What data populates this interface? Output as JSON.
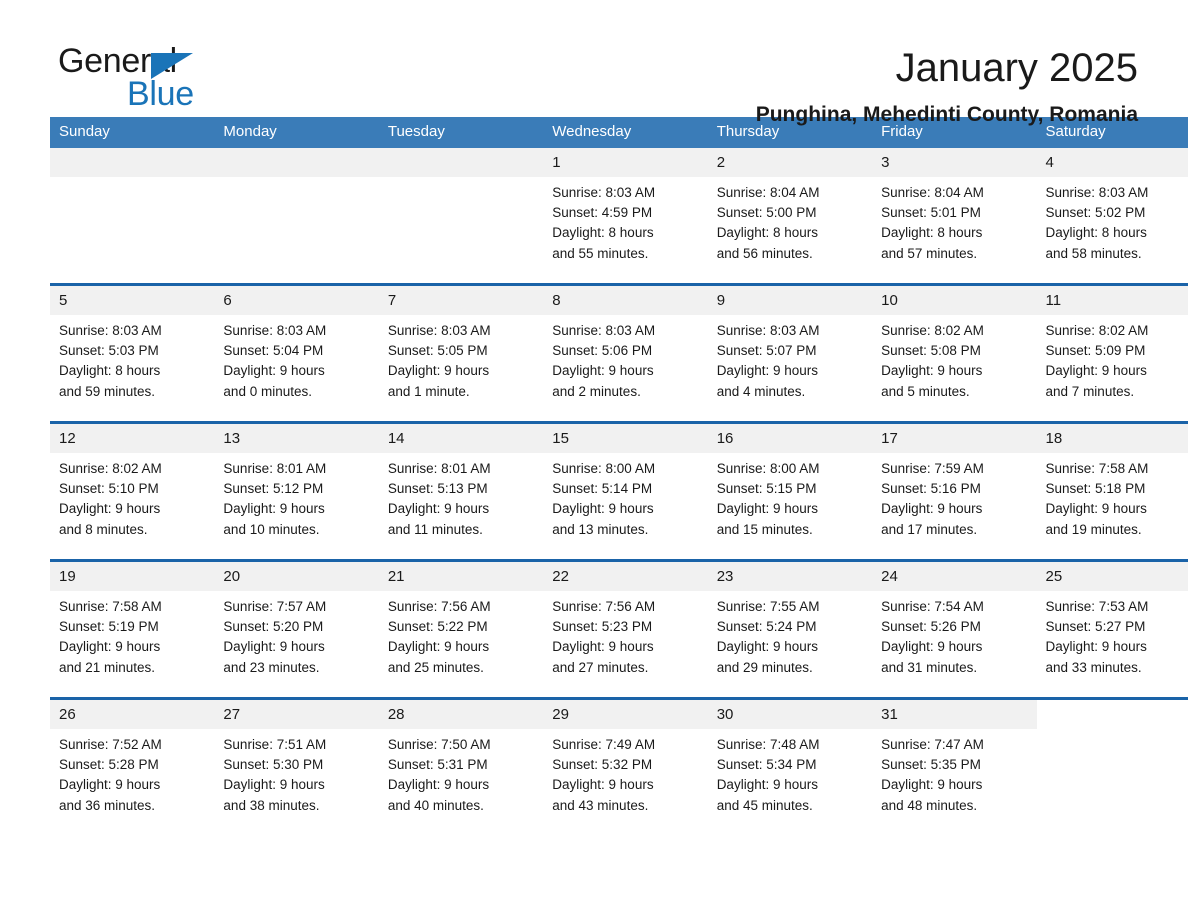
{
  "brand": {
    "name_part1": "General",
    "name_part2": "Blue",
    "triangle_color": "#1a74b8"
  },
  "header": {
    "title": "January 2025",
    "location": "Punghina, Mehedinti County, Romania"
  },
  "calendar": {
    "accent_color": "#3a7cb8",
    "rule_color": "#1a63a8",
    "daynum_bg": "#f1f1f1",
    "weekday_headers": [
      "Sunday",
      "Monday",
      "Tuesday",
      "Wednesday",
      "Thursday",
      "Friday",
      "Saturday"
    ],
    "weeks": [
      [
        {
          "day": "",
          "sunrise": "",
          "sunset": "",
          "daylight1": "",
          "daylight2": "",
          "blank": true
        },
        {
          "day": "",
          "sunrise": "",
          "sunset": "",
          "daylight1": "",
          "daylight2": "",
          "blank": true
        },
        {
          "day": "",
          "sunrise": "",
          "sunset": "",
          "daylight1": "",
          "daylight2": "",
          "blank": true
        },
        {
          "day": "1",
          "sunrise": "Sunrise: 8:03 AM",
          "sunset": "Sunset: 4:59 PM",
          "daylight1": "Daylight: 8 hours",
          "daylight2": "and 55 minutes."
        },
        {
          "day": "2",
          "sunrise": "Sunrise: 8:04 AM",
          "sunset": "Sunset: 5:00 PM",
          "daylight1": "Daylight: 8 hours",
          "daylight2": "and 56 minutes."
        },
        {
          "day": "3",
          "sunrise": "Sunrise: 8:04 AM",
          "sunset": "Sunset: 5:01 PM",
          "daylight1": "Daylight: 8 hours",
          "daylight2": "and 57 minutes."
        },
        {
          "day": "4",
          "sunrise": "Sunrise: 8:03 AM",
          "sunset": "Sunset: 5:02 PM",
          "daylight1": "Daylight: 8 hours",
          "daylight2": "and 58 minutes."
        }
      ],
      [
        {
          "day": "5",
          "sunrise": "Sunrise: 8:03 AM",
          "sunset": "Sunset: 5:03 PM",
          "daylight1": "Daylight: 8 hours",
          "daylight2": "and 59 minutes."
        },
        {
          "day": "6",
          "sunrise": "Sunrise: 8:03 AM",
          "sunset": "Sunset: 5:04 PM",
          "daylight1": "Daylight: 9 hours",
          "daylight2": "and 0 minutes."
        },
        {
          "day": "7",
          "sunrise": "Sunrise: 8:03 AM",
          "sunset": "Sunset: 5:05 PM",
          "daylight1": "Daylight: 9 hours",
          "daylight2": "and 1 minute."
        },
        {
          "day": "8",
          "sunrise": "Sunrise: 8:03 AM",
          "sunset": "Sunset: 5:06 PM",
          "daylight1": "Daylight: 9 hours",
          "daylight2": "and 2 minutes."
        },
        {
          "day": "9",
          "sunrise": "Sunrise: 8:03 AM",
          "sunset": "Sunset: 5:07 PM",
          "daylight1": "Daylight: 9 hours",
          "daylight2": "and 4 minutes."
        },
        {
          "day": "10",
          "sunrise": "Sunrise: 8:02 AM",
          "sunset": "Sunset: 5:08 PM",
          "daylight1": "Daylight: 9 hours",
          "daylight2": "and 5 minutes."
        },
        {
          "day": "11",
          "sunrise": "Sunrise: 8:02 AM",
          "sunset": "Sunset: 5:09 PM",
          "daylight1": "Daylight: 9 hours",
          "daylight2": "and 7 minutes."
        }
      ],
      [
        {
          "day": "12",
          "sunrise": "Sunrise: 8:02 AM",
          "sunset": "Sunset: 5:10 PM",
          "daylight1": "Daylight: 9 hours",
          "daylight2": "and 8 minutes."
        },
        {
          "day": "13",
          "sunrise": "Sunrise: 8:01 AM",
          "sunset": "Sunset: 5:12 PM",
          "daylight1": "Daylight: 9 hours",
          "daylight2": "and 10 minutes."
        },
        {
          "day": "14",
          "sunrise": "Sunrise: 8:01 AM",
          "sunset": "Sunset: 5:13 PM",
          "daylight1": "Daylight: 9 hours",
          "daylight2": "and 11 minutes."
        },
        {
          "day": "15",
          "sunrise": "Sunrise: 8:00 AM",
          "sunset": "Sunset: 5:14 PM",
          "daylight1": "Daylight: 9 hours",
          "daylight2": "and 13 minutes."
        },
        {
          "day": "16",
          "sunrise": "Sunrise: 8:00 AM",
          "sunset": "Sunset: 5:15 PM",
          "daylight1": "Daylight: 9 hours",
          "daylight2": "and 15 minutes."
        },
        {
          "day": "17",
          "sunrise": "Sunrise: 7:59 AM",
          "sunset": "Sunset: 5:16 PM",
          "daylight1": "Daylight: 9 hours",
          "daylight2": "and 17 minutes."
        },
        {
          "day": "18",
          "sunrise": "Sunrise: 7:58 AM",
          "sunset": "Sunset: 5:18 PM",
          "daylight1": "Daylight: 9 hours",
          "daylight2": "and 19 minutes."
        }
      ],
      [
        {
          "day": "19",
          "sunrise": "Sunrise: 7:58 AM",
          "sunset": "Sunset: 5:19 PM",
          "daylight1": "Daylight: 9 hours",
          "daylight2": "and 21 minutes."
        },
        {
          "day": "20",
          "sunrise": "Sunrise: 7:57 AM",
          "sunset": "Sunset: 5:20 PM",
          "daylight1": "Daylight: 9 hours",
          "daylight2": "and 23 minutes."
        },
        {
          "day": "21",
          "sunrise": "Sunrise: 7:56 AM",
          "sunset": "Sunset: 5:22 PM",
          "daylight1": "Daylight: 9 hours",
          "daylight2": "and 25 minutes."
        },
        {
          "day": "22",
          "sunrise": "Sunrise: 7:56 AM",
          "sunset": "Sunset: 5:23 PM",
          "daylight1": "Daylight: 9 hours",
          "daylight2": "and 27 minutes."
        },
        {
          "day": "23",
          "sunrise": "Sunrise: 7:55 AM",
          "sunset": "Sunset: 5:24 PM",
          "daylight1": "Daylight: 9 hours",
          "daylight2": "and 29 minutes."
        },
        {
          "day": "24",
          "sunrise": "Sunrise: 7:54 AM",
          "sunset": "Sunset: 5:26 PM",
          "daylight1": "Daylight: 9 hours",
          "daylight2": "and 31 minutes."
        },
        {
          "day": "25",
          "sunrise": "Sunrise: 7:53 AM",
          "sunset": "Sunset: 5:27 PM",
          "daylight1": "Daylight: 9 hours",
          "daylight2": "and 33 minutes."
        }
      ],
      [
        {
          "day": "26",
          "sunrise": "Sunrise: 7:52 AM",
          "sunset": "Sunset: 5:28 PM",
          "daylight1": "Daylight: 9 hours",
          "daylight2": "and 36 minutes."
        },
        {
          "day": "27",
          "sunrise": "Sunrise: 7:51 AM",
          "sunset": "Sunset: 5:30 PM",
          "daylight1": "Daylight: 9 hours",
          "daylight2": "and 38 minutes."
        },
        {
          "day": "28",
          "sunrise": "Sunrise: 7:50 AM",
          "sunset": "Sunset: 5:31 PM",
          "daylight1": "Daylight: 9 hours",
          "daylight2": "and 40 minutes."
        },
        {
          "day": "29",
          "sunrise": "Sunrise: 7:49 AM",
          "sunset": "Sunset: 5:32 PM",
          "daylight1": "Daylight: 9 hours",
          "daylight2": "and 43 minutes."
        },
        {
          "day": "30",
          "sunrise": "Sunrise: 7:48 AM",
          "sunset": "Sunset: 5:34 PM",
          "daylight1": "Daylight: 9 hours",
          "daylight2": "and 45 minutes."
        },
        {
          "day": "31",
          "sunrise": "Sunrise: 7:47 AM",
          "sunset": "Sunset: 5:35 PM",
          "daylight1": "Daylight: 9 hours",
          "daylight2": "and 48 minutes."
        },
        {
          "day": "",
          "sunrise": "",
          "sunset": "",
          "daylight1": "",
          "daylight2": "",
          "nocell": true
        }
      ]
    ]
  }
}
